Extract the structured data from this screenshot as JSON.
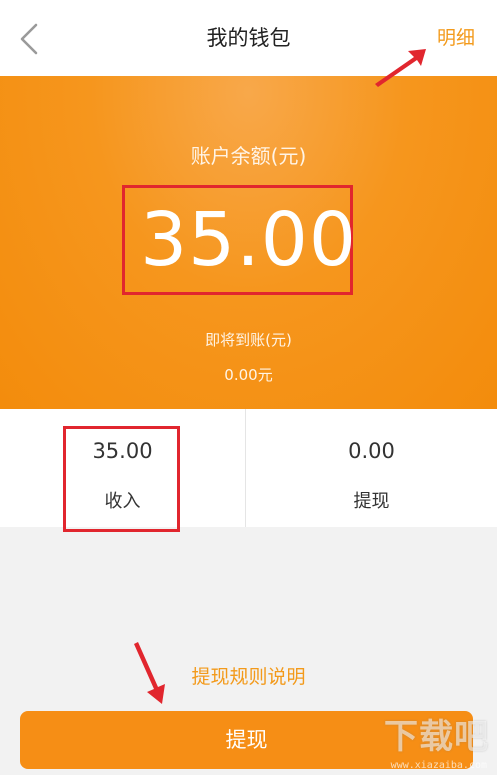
{
  "header": {
    "title": "我的钱包",
    "detail_link": "明细",
    "back_icon": "chevron-left-icon"
  },
  "balance": {
    "label": "账户余额(元)",
    "value": "35.00",
    "pending_label": "即将到账(元)",
    "pending_value": "0.00元"
  },
  "stats": [
    {
      "value": "35.00",
      "label": "收入"
    },
    {
      "value": "0.00",
      "label": "提现"
    }
  ],
  "rules_link": "提现规则说明",
  "withdraw_button": "提现",
  "watermark": {
    "text": "下载吧",
    "url": "www.xiazaiba.com"
  },
  "colors": {
    "accent": "#f39a1b",
    "hero": "#f6961d",
    "highlight_box": "#e1262e",
    "button": "#f68e15"
  }
}
